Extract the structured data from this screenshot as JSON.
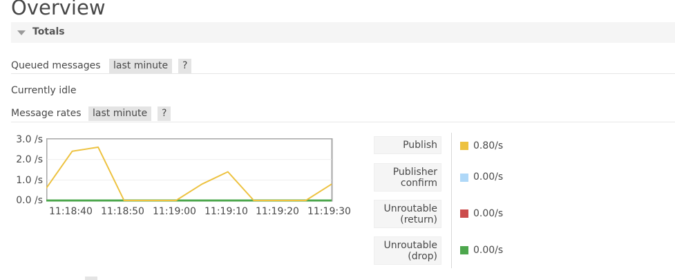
{
  "page": {
    "title": "Overview"
  },
  "totals": {
    "section_title": "Totals",
    "queued": {
      "label": "Queued messages",
      "range": "last minute",
      "help": "?"
    },
    "idle_text": "Currently idle",
    "rates": {
      "label": "Message rates",
      "range": "last minute",
      "help": "?"
    }
  },
  "chart_data": {
    "type": "line",
    "ylim": [
      0,
      3
    ],
    "y_ticks": [
      "3.0 /s",
      "2.0 /s",
      "1.0 /s",
      "0.0 /s"
    ],
    "x_ticks": [
      "11:18:40",
      "11:18:50",
      "11:19:00",
      "11:19:10",
      "11:19:20",
      "11:19:30"
    ],
    "series": [
      {
        "name": "Publish",
        "color": "#edc240",
        "points": [
          [
            0,
            0.6
          ],
          [
            5,
            2.4
          ],
          [
            10,
            2.6
          ],
          [
            15,
            0.0
          ],
          [
            20,
            0.0
          ],
          [
            25,
            0.0
          ],
          [
            30,
            0.8
          ],
          [
            35,
            1.4
          ],
          [
            40,
            0.0
          ],
          [
            45,
            0.0
          ],
          [
            50,
            0.0
          ],
          [
            55,
            0.8
          ]
        ]
      },
      {
        "name": "Publisher confirm",
        "color": "#afd8f8",
        "points": [
          [
            0,
            0
          ],
          [
            55,
            0
          ]
        ]
      },
      {
        "name": "Unroutable (return)",
        "color": "#cb4b4b",
        "points": [
          [
            0,
            0
          ],
          [
            55,
            0
          ]
        ]
      },
      {
        "name": "Unroutable (drop)",
        "color": "#4da74d",
        "points": [
          [
            0,
            0
          ],
          [
            55,
            0
          ]
        ]
      }
    ],
    "grid": true
  },
  "legend": {
    "items": [
      {
        "label_line1": "Publish",
        "label_line2": "",
        "rate": "0.80/s",
        "color": "#edc240"
      },
      {
        "label_line1": "Publisher",
        "label_line2": "confirm",
        "rate": "0.00/s",
        "color": "#afd8f8"
      },
      {
        "label_line1": "Unroutable",
        "label_line2": "(return)",
        "rate": "0.00/s",
        "color": "#cb4b4b"
      },
      {
        "label_line1": "Unroutable",
        "label_line2": "(drop)",
        "rate": "0.00/s",
        "color": "#4da74d"
      }
    ]
  }
}
